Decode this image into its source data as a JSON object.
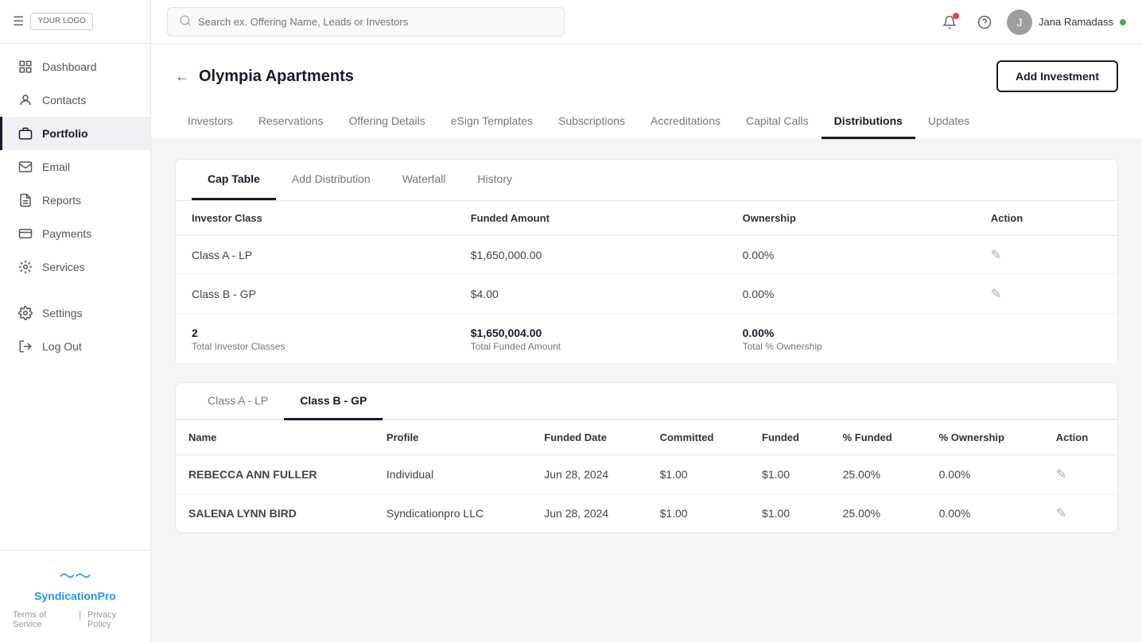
{
  "sidebar": {
    "logo": "YOUR LOGO",
    "items": [
      {
        "id": "dashboard",
        "label": "Dashboard",
        "active": false
      },
      {
        "id": "contacts",
        "label": "Contacts",
        "active": false
      },
      {
        "id": "portfolio",
        "label": "Portfolio",
        "active": true
      },
      {
        "id": "email",
        "label": "Email",
        "active": false
      },
      {
        "id": "reports",
        "label": "Reports",
        "active": false
      },
      {
        "id": "payments",
        "label": "Payments",
        "active": false
      },
      {
        "id": "services",
        "label": "Services",
        "active": false
      }
    ],
    "settings_label": "Settings",
    "logout_label": "Log Out",
    "brand_name_part1": "Syndication",
    "brand_name_part2": "Pro",
    "footer_tos": "Terms of Service",
    "footer_privacy": "Privacy Policy"
  },
  "topbar": {
    "search_placeholder": "Search ex. Offering Name, Leads or Investors",
    "user_name": "Jana Ramadass"
  },
  "page": {
    "title": "Olympia Apartments",
    "add_investment_label": "Add Investment",
    "main_tabs": [
      {
        "id": "investors",
        "label": "Investors",
        "active": false
      },
      {
        "id": "reservations",
        "label": "Reservations",
        "active": false
      },
      {
        "id": "offering-details",
        "label": "Offering Details",
        "active": false
      },
      {
        "id": "esign-templates",
        "label": "eSign Templates",
        "active": false
      },
      {
        "id": "subscriptions",
        "label": "Subscriptions",
        "active": false
      },
      {
        "id": "accreditations",
        "label": "Accreditations",
        "active": false
      },
      {
        "id": "capital-calls",
        "label": "Capital Calls",
        "active": false
      },
      {
        "id": "distributions",
        "label": "Distributions",
        "active": true
      },
      {
        "id": "updates",
        "label": "Updates",
        "active": false
      }
    ]
  },
  "distributions": {
    "sub_tabs": [
      {
        "id": "cap-table",
        "label": "Cap Table",
        "active": true
      },
      {
        "id": "add-distribution",
        "label": "Add Distribution",
        "active": false
      },
      {
        "id": "waterfall",
        "label": "Waterfall",
        "active": false
      },
      {
        "id": "history",
        "label": "History",
        "active": false
      }
    ],
    "cap_table": {
      "columns": [
        "Investor Class",
        "Funded Amount",
        "Ownership",
        "Action"
      ],
      "rows": [
        {
          "investor_class": "Class A - LP",
          "funded_amount": "$1,650,000.00",
          "ownership": "0.00%"
        },
        {
          "investor_class": "Class B - GP",
          "funded_amount": "$4.00",
          "ownership": "0.00%"
        }
      ],
      "totals": {
        "count": "2",
        "count_label": "Total Investor Classes",
        "total_funded": "$1,650,004.00",
        "total_funded_label": "Total Funded Amount",
        "total_ownership": "0.00%",
        "total_ownership_label": "Total % Ownership"
      }
    },
    "investor_tabs": [
      {
        "id": "class-a-lp",
        "label": "Class A - LP",
        "active": false
      },
      {
        "id": "class-b-gp",
        "label": "Class B - GP",
        "active": true
      }
    ],
    "investors_table": {
      "columns": [
        "Name",
        "Profile",
        "Funded Date",
        "Committed",
        "Funded",
        "% Funded",
        "% Ownership",
        "Action"
      ],
      "rows": [
        {
          "name": "REBECCA ANN FULLER",
          "profile": "Individual",
          "funded_date": "Jun 28, 2024",
          "committed": "$1.00",
          "funded": "$1.00",
          "pct_funded": "25.00%",
          "pct_ownership": "0.00%"
        },
        {
          "name": "SALENA LYNN BIRD",
          "profile": "Syndicationpro LLC",
          "funded_date": "Jun 28, 2024",
          "committed": "$1.00",
          "funded": "$1.00",
          "pct_funded": "25.00%",
          "pct_ownership": "0.00%"
        }
      ]
    }
  }
}
